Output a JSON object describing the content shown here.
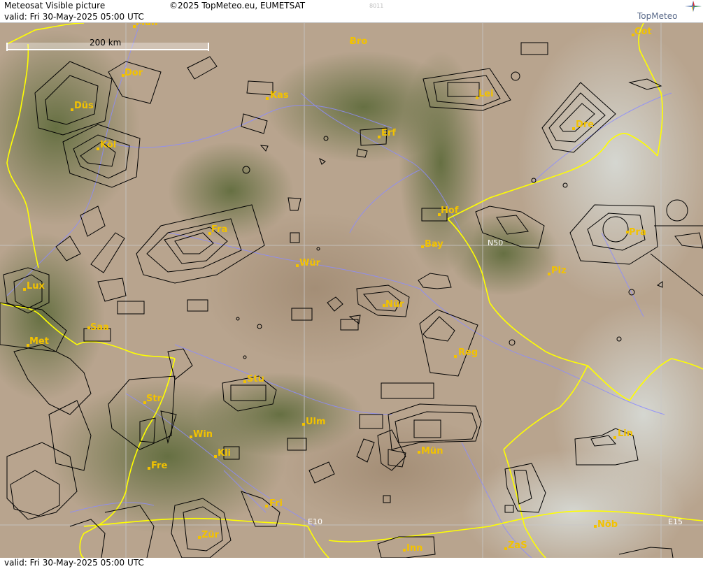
{
  "header": {
    "title": "Meteosat Visible picture",
    "copyright": "©2025 TopMeteo.eu, EUMETSAT",
    "code": "8011",
    "valid": "valid:  Fri  30-May-2025  05:00 UTC",
    "logo": "TopMeteo"
  },
  "footer": {
    "valid": "valid:  Fri  30-May-2025  05:00 UTC"
  },
  "scale": {
    "label": "200 km"
  },
  "grid_labels": {
    "n50": "N50",
    "e10": "E10",
    "e15": "E15"
  },
  "cities": [
    {
      "id": "mun-top",
      "name": "Mün"
    },
    {
      "id": "bro",
      "name": "Bro"
    },
    {
      "id": "cot",
      "name": "Cot"
    },
    {
      "id": "dor",
      "name": "Dor"
    },
    {
      "id": "kas",
      "name": "Kas"
    },
    {
      "id": "lei",
      "name": "Lei"
    },
    {
      "id": "dus",
      "name": "Düs"
    },
    {
      "id": "erf",
      "name": "Erf"
    },
    {
      "id": "dre",
      "name": "Dre"
    },
    {
      "id": "kol",
      "name": "Köl"
    },
    {
      "id": "hof",
      "name": "Hof"
    },
    {
      "id": "fra",
      "name": "Fra"
    },
    {
      "id": "pra",
      "name": "Pra"
    },
    {
      "id": "bay",
      "name": "Bay"
    },
    {
      "id": "wur",
      "name": "Wür"
    },
    {
      "id": "plz",
      "name": "Plz"
    },
    {
      "id": "lux",
      "name": "Lux"
    },
    {
      "id": "nur",
      "name": "Nür"
    },
    {
      "id": "saa",
      "name": "Saa"
    },
    {
      "id": "met",
      "name": "Met"
    },
    {
      "id": "reg",
      "name": "Reg"
    },
    {
      "id": "stu",
      "name": "Stu"
    },
    {
      "id": "str",
      "name": "Str"
    },
    {
      "id": "ulm",
      "name": "Ulm"
    },
    {
      "id": "win",
      "name": "Win"
    },
    {
      "id": "lin",
      "name": "Lin"
    },
    {
      "id": "kli",
      "name": "Kli"
    },
    {
      "id": "mun",
      "name": "Mün"
    },
    {
      "id": "fre",
      "name": "Fre"
    },
    {
      "id": "fri",
      "name": "Fri"
    },
    {
      "id": "nob",
      "name": "Nöb"
    },
    {
      "id": "zur",
      "name": "Zür"
    },
    {
      "id": "inn",
      "name": "Inn"
    },
    {
      "id": "zas",
      "name": "ZaS"
    }
  ],
  "colors": {
    "city": "#f2c200",
    "border": "#ffff00",
    "river": "#8c8cff",
    "grid": "#c8c8c8",
    "airspace": "#000000"
  }
}
